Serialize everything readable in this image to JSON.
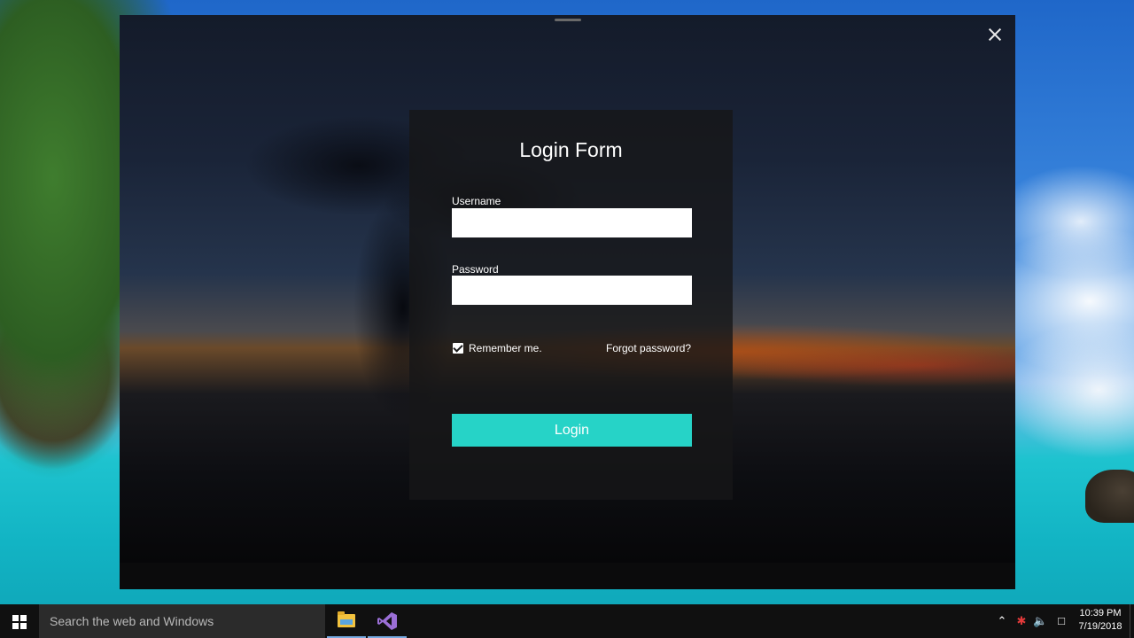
{
  "login_form": {
    "title": "Login Form",
    "username_label": "Username",
    "username_value": "",
    "password_label": "Password",
    "password_value": "",
    "remember_label": "Remember me.",
    "remember_checked": true,
    "forgot_label": "Forgot password?",
    "login_button": "Login"
  },
  "taskbar": {
    "search_placeholder": "Search the web and Windows",
    "apps": [
      {
        "icon": "file-explorer-icon"
      },
      {
        "icon": "visual-studio-icon"
      }
    ],
    "tray": {
      "time": "10:39 PM",
      "date": "7/19/2018"
    }
  },
  "colors": {
    "accent": "#26d3c7",
    "taskbar": "#101010"
  }
}
